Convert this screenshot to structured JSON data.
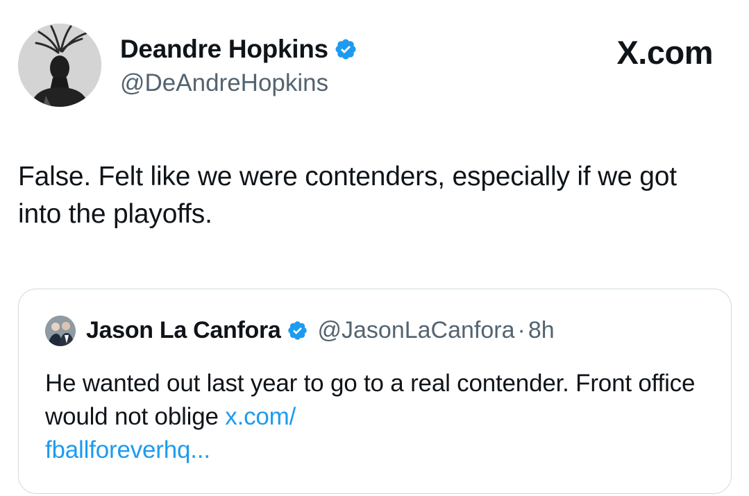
{
  "author": {
    "name": "Deandre Hopkins",
    "handle": "@DeAndreHopkins",
    "verified": true
  },
  "site_logo": "X.com",
  "tweet": {
    "text": "False. Felt like we were contenders, especially if we got into the playoffs."
  },
  "quoted_tweet": {
    "author_name": "Jason La Canfora",
    "handle": "@JasonLaCanfora",
    "separator": "·",
    "time": "8h",
    "verified": true,
    "text": "He wanted out last year to go to a real contender. Front office would not oblige ",
    "link_line1": "x.com/",
    "link_line2": "fballforeverhq..."
  },
  "colors": {
    "verified_badge": "#1d9bf0",
    "link": "#1d9bf0",
    "secondary_text": "#536471",
    "border": "#cfd9de"
  },
  "icons": {
    "verified": "verified-badge-icon"
  }
}
